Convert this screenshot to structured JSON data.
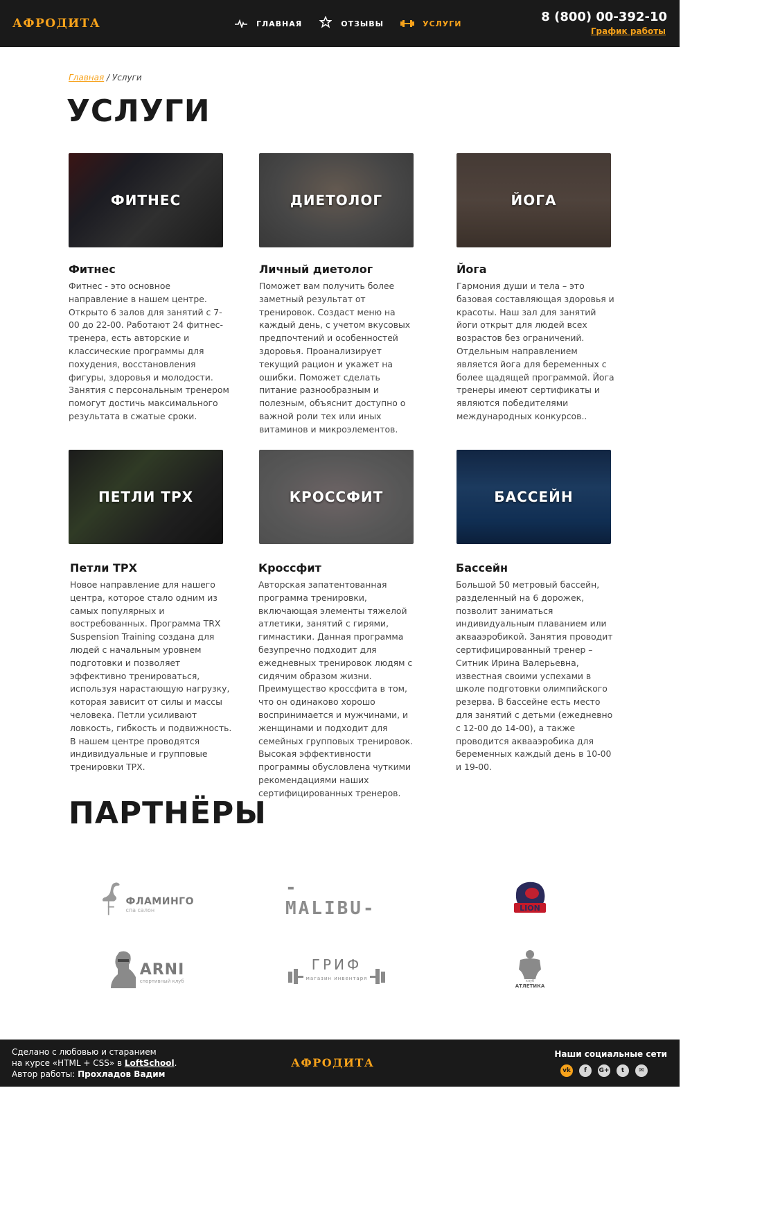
{
  "header": {
    "logo": "АФРОДИТА",
    "nav": [
      {
        "label": "ГЛАВНАЯ",
        "icon": "pulse-icon"
      },
      {
        "label": "ОТЗЫВЫ",
        "icon": "star-icon"
      },
      {
        "label": "УСЛУГИ",
        "icon": "dumbbell-icon"
      }
    ],
    "phone": "8 (800) 00-392-10",
    "schedule_link": "График работы"
  },
  "breadcrumb": {
    "home": "Главная",
    "separator": " / ",
    "current": "Услуги"
  },
  "page_title": "УСЛУГИ",
  "services": [
    {
      "image_label": "ФИТНЕС",
      "title": "Фитнес",
      "text": "Фитнес - это основное направление в нашем центре. Открыто 6 залов для занятий с 7-00 до 22-00. Работают 24 фитнес-тренера, есть авторские и классические программы для похудения, восстановления фигуры, здоровья и молодости. Занятия с персональным тренером помогут достичь максимального результата в сжатые сроки."
    },
    {
      "image_label": "ДИЕТОЛОГ",
      "title": "Личный диетолог",
      "text": "Поможет вам получить более заметный результат от тренировок. Создаст меню на каждый день, с учетом вкусовых предпочтений и особенностей здоровья. Проанализирует текущий рацион и укажет на ошибки. Поможет сделать питание разнообразным и полезным, объяснит доступно о важной роли тех или иных витаминов и микроэлементов."
    },
    {
      "image_label": "ЙОГА",
      "title": "Йога",
      "text": "Гармония души и тела – это базовая составляющая здоровья и красоты. Наш зал для занятий йоги открыт для людей всех возрастов без ограничений. Отдельным направлением является йога для беременных с более щадящей программой. Йога тренеры имеют сертификаты и являются победителями международных конкурсов.."
    },
    {
      "image_label": "ПЕТЛИ TPX",
      "title": "Петли TPX",
      "text": "Новое направление для нашего центра, которое стало одним из самых популярных и востребованных. Программа TRX Suspension Training создана для людей с начальным уровнем подготовки и позволяет эффективно тренироваться, используя нарастающую нагрузку, которая зависит от силы и массы человека. Петли усиливают ловкость, гибкость и подвижность. В нашем центре проводятся индивидуальные и групповые тренировки TPX."
    },
    {
      "image_label": "КРОССФИТ",
      "title": "Кроссфит",
      "text": "Авторская запатентованная программа тренировки, включающая элементы тяжелой атлетики, занятий с гирями, гимнастики. Данная программа безупречно подходит для ежедневных тренировок людям с сидячим образом жизни. Преимущество кроссфита в том, что он одинаково хорошо воспринимается и мужчинами, и женщинами и подходит для семейных групповых тренировок. Высокая эффективности программы обусловлена чуткими рекомендациями наших сертифицированных тренеров."
    },
    {
      "image_label": "БАССЕЙН",
      "title": "Бассейн",
      "text": "Большой 50 метровый бассейн, разделенный на 6 дорожек, позволит заниматься индивидуальным плаванием или аквааэробикой. Занятия проводит сертифицированный тренер – Ситник Ирина Валерьевна, известная своими успехами в школе подготовки олимпийского резерва. В бассейне есть место для занятий с детьми (ежедневно с 12-00 до 14-00), а также проводится аквааэробика для беременных каждый день в 10-00 и 19-00."
    }
  ],
  "partners": {
    "title": "ПАРТНЁРЫ",
    "items": [
      {
        "name": "ФЛАМИНГО",
        "sub": "спа салон",
        "icon": "flamingo-logo"
      },
      {
        "name": "-MALIBU-",
        "sub": "",
        "icon": "malibu-logo"
      },
      {
        "name": "LION",
        "sub": "",
        "icon": "lion-logo"
      },
      {
        "name": "ARNI",
        "sub": "спортивный клуб",
        "icon": "arni-logo"
      },
      {
        "name": "ГРИФ",
        "sub": "магазин инвентаря",
        "icon": "grif-logo"
      },
      {
        "name": "АТЛЕТИКА",
        "sub": "клуб",
        "icon": "atletika-logo"
      }
    ]
  },
  "footer": {
    "line1": "Сделано с любовью и старанием",
    "line2_prefix": "на курсе «HTML + CSS» в ",
    "line2_link": "LoftSchool",
    "line2_suffix": ".",
    "line3_prefix": "Автор работы: ",
    "line3_author": "Прохладов Вадим",
    "logo": "АФРОДИТА",
    "social_title": "Наши социальные сети",
    "social": [
      {
        "icon": "vk-icon",
        "glyph": "vk"
      },
      {
        "icon": "facebook-icon",
        "glyph": "f"
      },
      {
        "icon": "google-plus-icon",
        "glyph": "G+"
      },
      {
        "icon": "twitter-icon",
        "glyph": "t"
      },
      {
        "icon": "email-icon",
        "glyph": "✉"
      }
    ]
  },
  "colors": {
    "accent": "#f7a21b",
    "header_bg": "#1a1a1a",
    "text": "#333333"
  }
}
